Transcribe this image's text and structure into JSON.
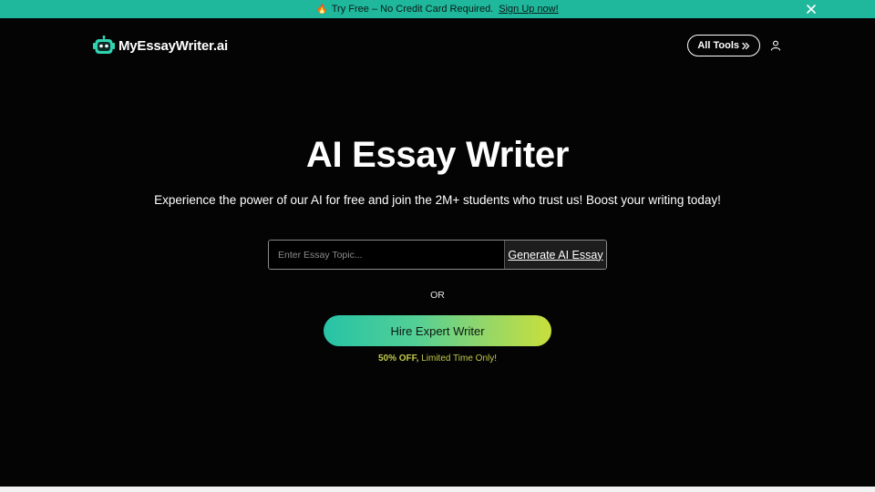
{
  "promo": {
    "fire_glyph": "🔥",
    "text": "Try Free – No Credit Card Required.",
    "link_text": "Sign Up now!",
    "close_glyph": "✕"
  },
  "header": {
    "logo_text": "MyEssayWriter.ai",
    "all_tools_label": "All Tools",
    "all_tools_icon": "chevrons-right-icon",
    "user_icon": "user-icon"
  },
  "hero": {
    "title": "AI Essay Writer",
    "subtitle": "Experience the power of our AI for free and join the 2M+ students who trust us! Boost your writing today!"
  },
  "topic_form": {
    "value": "",
    "placeholder": "Enter Essay Topic...",
    "generate_label": "Generate AI Essay"
  },
  "divider_text": "OR",
  "hire": {
    "label": "Hire Expert Writer",
    "offer_bold": "50% OFF,",
    "offer_rest": " Limited Time Only!"
  },
  "colors": {
    "promo_bg": "#1fb89c",
    "page_bg": "#040404",
    "gradient_start": "#27c3a6",
    "gradient_end": "#c8df3c",
    "offer_text": "#c2c94a"
  }
}
